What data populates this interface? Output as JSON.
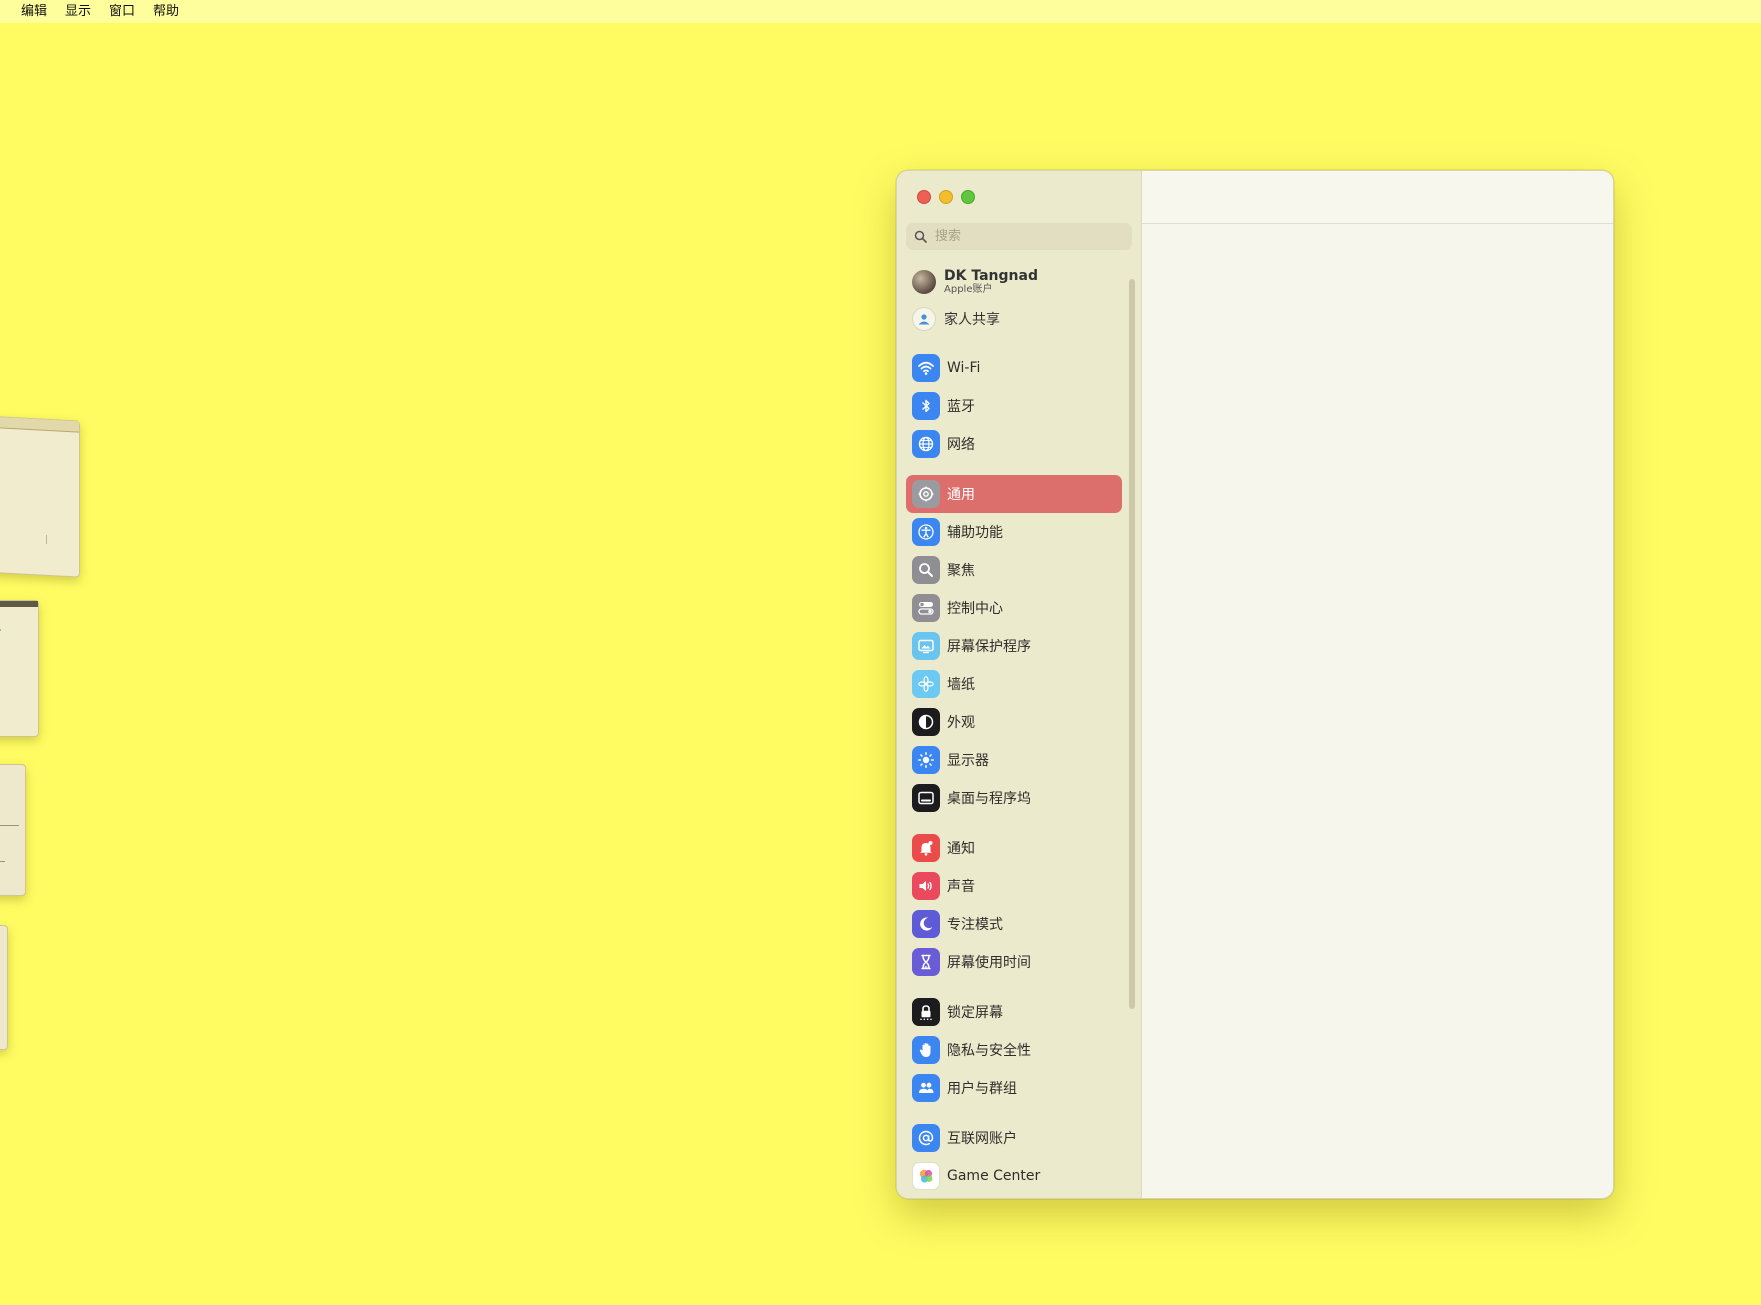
{
  "menubar": {
    "items": [
      "编辑",
      "显示",
      "窗口",
      "帮助"
    ]
  },
  "search": {
    "placeholder": "搜索"
  },
  "account": {
    "name": "DK Tangnad",
    "subtitle": "Apple账户"
  },
  "family": {
    "label": "家人共享"
  },
  "sections": [
    [
      {
        "label": "Wi-Fi",
        "icon": "wifi-icon",
        "color": "#3b86f0"
      },
      {
        "label": "蓝牙",
        "icon": "bluetooth-icon",
        "color": "#3b86f0"
      },
      {
        "label": "网络",
        "icon": "globe-icon",
        "color": "#3b86f0"
      }
    ],
    [
      {
        "label": "通用",
        "icon": "gear-icon",
        "color": "#9a9a9f",
        "selected": true
      },
      {
        "label": "辅助功能",
        "icon": "accessibility-icon",
        "color": "#3b86f0"
      },
      {
        "label": "聚焦",
        "icon": "magnifier-icon",
        "color": "#8e8e93"
      },
      {
        "label": "控制中心",
        "icon": "toggles-icon",
        "color": "#8e8e93"
      },
      {
        "label": "屏幕保护程序",
        "icon": "screensaver-icon",
        "color": "#69c5f0"
      },
      {
        "label": "墙纸",
        "icon": "flower-icon",
        "color": "#6cc9f2"
      },
      {
        "label": "外观",
        "icon": "appearance-icon",
        "color": "#1c1c1e"
      },
      {
        "label": "显示器",
        "icon": "sun-icon",
        "color": "#3b86f0"
      },
      {
        "label": "桌面与程序坞",
        "icon": "dock-icon",
        "color": "#1c1c1e"
      }
    ],
    [
      {
        "label": "通知",
        "icon": "bell-icon",
        "color": "#eb4b4b"
      },
      {
        "label": "声音",
        "icon": "speaker-icon",
        "color": "#eb4a5e"
      },
      {
        "label": "专注模式",
        "icon": "moon-icon",
        "color": "#5f5bd6"
      },
      {
        "label": "屏幕使用时间",
        "icon": "hourglass-icon",
        "color": "#6a5bd6"
      }
    ],
    [
      {
        "label": "锁定屏幕",
        "icon": "lock-icon",
        "color": "#1c1c1e"
      },
      {
        "label": "隐私与安全性",
        "icon": "hand-icon",
        "color": "#3b86f0"
      },
      {
        "label": "用户与群组",
        "icon": "users-icon",
        "color": "#3b86f0"
      }
    ],
    [
      {
        "label": "互联网账户",
        "icon": "at-icon",
        "color": "#3b86f0"
      },
      {
        "label": "Game Center",
        "icon": "game-center-icon",
        "color": "#ffffff"
      }
    ]
  ]
}
